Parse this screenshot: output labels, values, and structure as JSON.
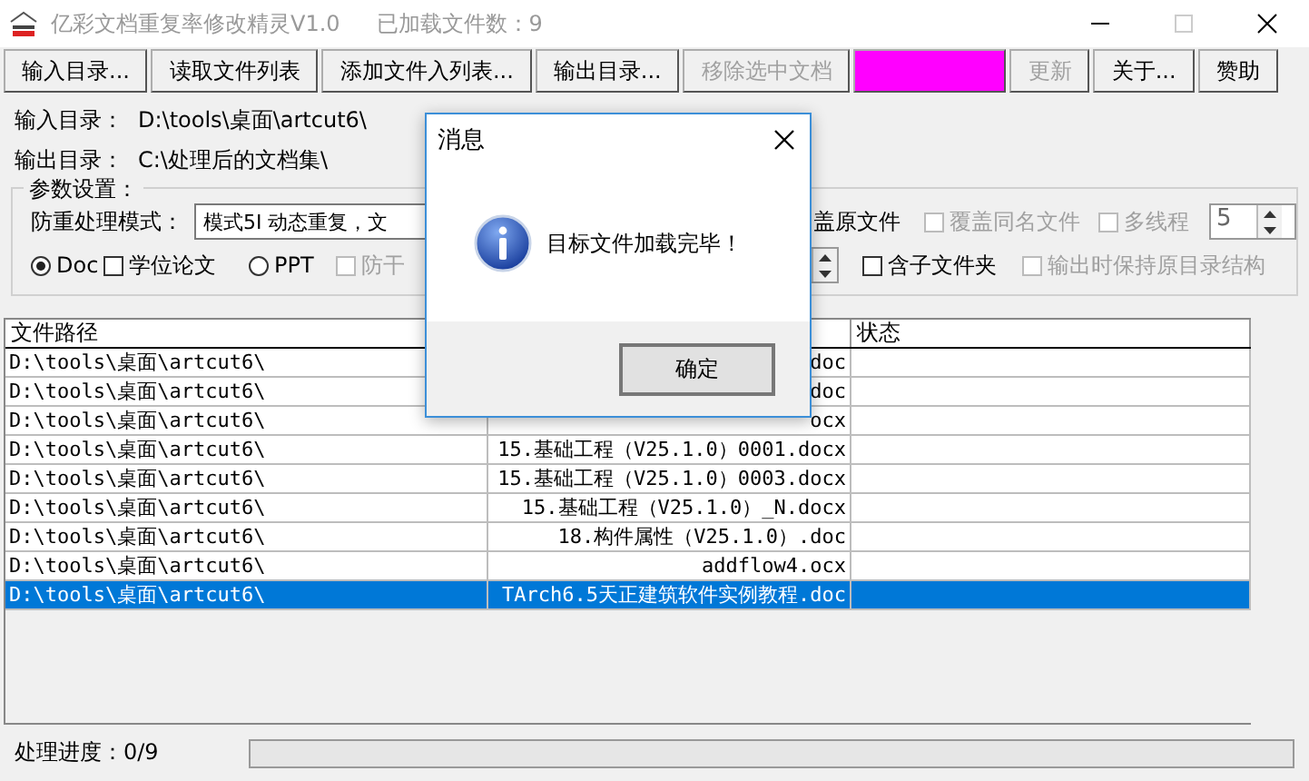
{
  "window": {
    "title": "亿彩文档重复率修改精灵V1.0",
    "loaded_count": "已加载文件数：9"
  },
  "toolbar": [
    {
      "kind": "normal",
      "label": "输入目录...",
      "disabled": false
    },
    {
      "kind": "normal",
      "label": "读取文件列表",
      "disabled": false
    },
    {
      "kind": "normal",
      "label": "添加文件入列表...",
      "disabled": false
    },
    {
      "kind": "normal",
      "label": "输出目录...",
      "disabled": false
    },
    {
      "kind": "normal",
      "label": "移除选中文档",
      "disabled": true
    },
    {
      "kind": "highlight"
    },
    {
      "kind": "normal",
      "label": "更新",
      "disabled": true
    },
    {
      "kind": "normal",
      "label": "关于...",
      "disabled": false
    },
    {
      "kind": "normal",
      "label": "赞助",
      "disabled": false
    }
  ],
  "paths": [
    {
      "label": "输入目录：",
      "value": "D:\\tools\\桌面\\artcut6\\"
    },
    {
      "label": "输出目录：",
      "value": "C:\\处理后的文档集\\"
    }
  ],
  "params": {
    "title": "参数设置：",
    "mode_label": "防重处理模式：",
    "mode_value": "模式5I 动态重复，文",
    "row1": [
      {
        "kind": "text",
        "label": "盖原文件"
      },
      {
        "kind": "checkbox",
        "label": "覆盖同名文件",
        "checked": false,
        "disabled": true
      },
      {
        "kind": "checkbox",
        "label": "多线程",
        "checked": false,
        "disabled": true
      },
      {
        "kind": "spin",
        "value": "5"
      }
    ],
    "row2": [
      {
        "kind": "radio",
        "label": "Doc",
        "selected": true,
        "disabled": false
      },
      {
        "kind": "checkbox",
        "label": "学位论文",
        "checked": false,
        "disabled": false
      },
      {
        "kind": "radio",
        "label": "PPT",
        "selected": false,
        "disabled": false
      },
      {
        "kind": "checkbox",
        "label": "防干",
        "checked": false,
        "disabled": true
      },
      {
        "kind": "spin"
      },
      {
        "kind": "checkbox",
        "label": "含子文件夹",
        "checked": false,
        "disabled": false
      },
      {
        "kind": "checkbox",
        "label": "输出时保持原目录结构",
        "checked": false,
        "disabled": true
      }
    ]
  },
  "table": {
    "columns": [
      "文件路径",
      "状态"
    ],
    "rows": [
      {
        "path": "D:\\tools\\桌面\\artcut6\\",
        "column_2": "doc",
        "selected": false
      },
      {
        "path": "D:\\tools\\桌面\\artcut6\\",
        "column_2": "doc",
        "selected": false
      },
      {
        "path": "D:\\tools\\桌面\\artcut6\\",
        "column_2": "ocx",
        "selected": false
      },
      {
        "path": "D:\\tools\\桌面\\artcut6\\",
        "column_2": "15.基础工程（V25.1.0）0001.docx",
        "selected": false
      },
      {
        "path": "D:\\tools\\桌面\\artcut6\\",
        "column_2": "15.基础工程（V25.1.0）0003.docx",
        "selected": false
      },
      {
        "path": "D:\\tools\\桌面\\artcut6\\",
        "column_2": "15.基础工程（V25.1.0）_N.docx",
        "selected": false
      },
      {
        "path": "D:\\tools\\桌面\\artcut6\\",
        "column_2": "18.构件属性（V25.1.0）.doc",
        "selected": false
      },
      {
        "path": "D:\\tools\\桌面\\artcut6\\",
        "column_2": "addflow4.ocx",
        "selected": false
      },
      {
        "path": "D:\\tools\\桌面\\artcut6\\",
        "column_2": "TArch6.5天正建筑软件实例教程.doc",
        "selected": true
      }
    ]
  },
  "status_bar": {
    "label": "处理进度：0/9",
    "progress": {
      "level": 0
    }
  },
  "dialog": {
    "title": "消息",
    "message": "目标文件加载完毕！",
    "button": "确定"
  }
}
